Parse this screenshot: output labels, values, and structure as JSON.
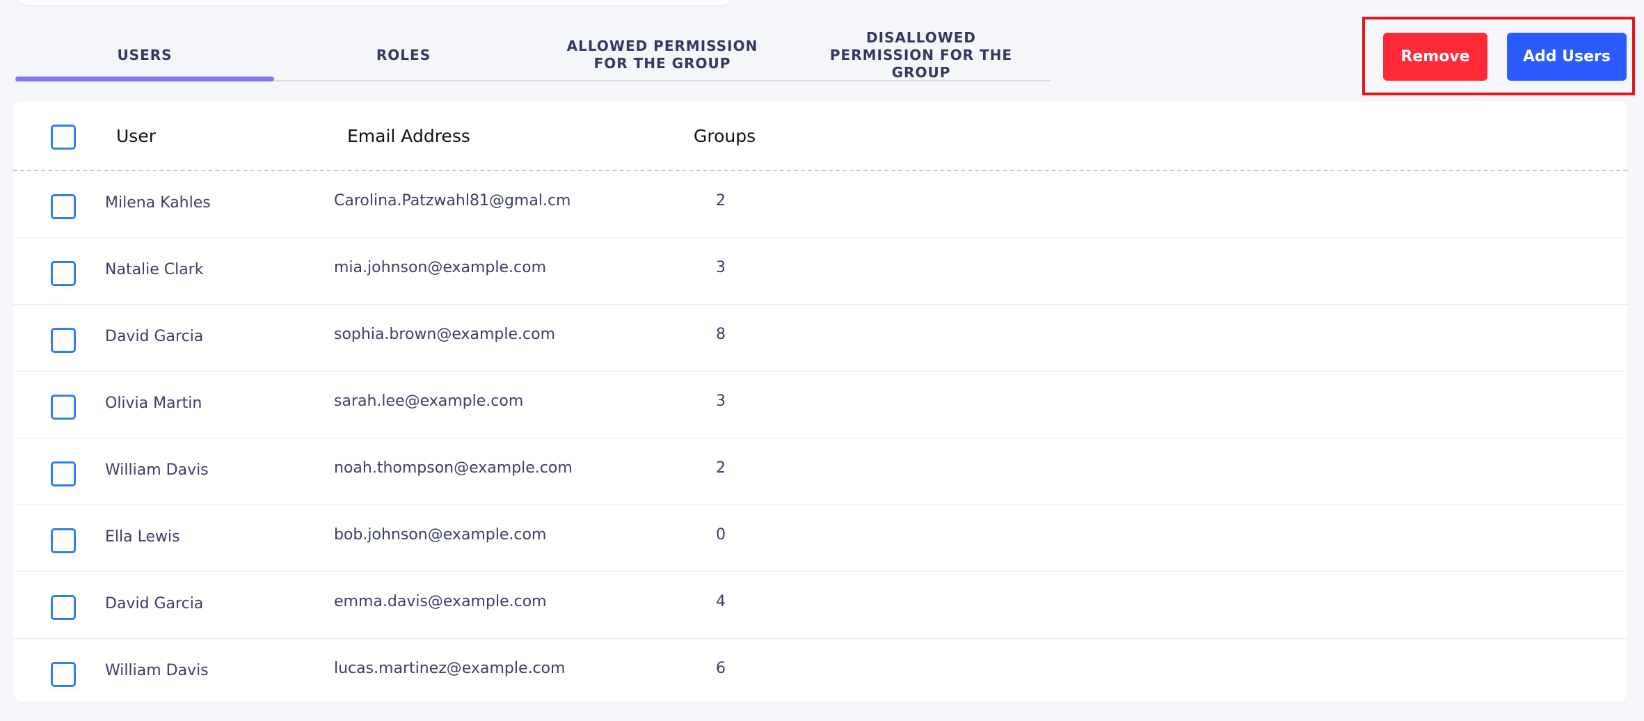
{
  "tabs": [
    {
      "label": "USERS",
      "active": true
    },
    {
      "label": "ROLES",
      "active": false
    },
    {
      "label": "ALLOWED PERMISSION FOR THE GROUP",
      "active": false
    },
    {
      "label": "DISALLOWED PERMISSION FOR THE GROUP",
      "active": false
    }
  ],
  "actions": {
    "remove_label": "Remove",
    "add_users_label": "Add Users"
  },
  "table": {
    "headers": {
      "user": "User",
      "email": "Email Address",
      "groups": "Groups"
    },
    "rows": [
      {
        "user": "Milena Kahles",
        "email": "Carolina.Patzwahl81@gmal.cm",
        "groups": "2"
      },
      {
        "user": "Natalie Clark",
        "email": "mia.johnson@example.com",
        "groups": "3"
      },
      {
        "user": "David Garcia",
        "email": "sophia.brown@example.com",
        "groups": "8"
      },
      {
        "user": "Olivia Martin",
        "email": "sarah.lee@example.com",
        "groups": "3"
      },
      {
        "user": "William Davis",
        "email": "noah.thompson@example.com",
        "groups": "2"
      },
      {
        "user": "Ella Lewis",
        "email": "bob.johnson@example.com",
        "groups": "0"
      },
      {
        "user": "David Garcia",
        "email": "emma.davis@example.com",
        "groups": "4"
      },
      {
        "user": "William Davis",
        "email": "lucas.martinez@example.com",
        "groups": "6"
      }
    ]
  },
  "colors": {
    "background": "#f5f6fa",
    "tab_indicator": "#8178ef",
    "remove_button": "#ff2a35",
    "add_button": "#2a5bff",
    "highlight_border": "#e1141e",
    "checkbox_border": "#2f80ed",
    "text_primary": "#3b3f66"
  }
}
